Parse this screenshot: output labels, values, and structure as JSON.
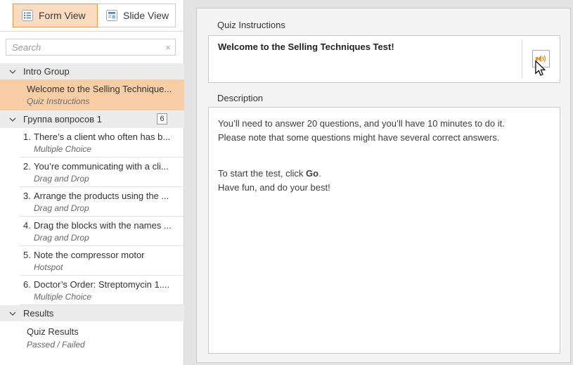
{
  "colors": {
    "window-bg": "#e3e3e3",
    "tab-selected-bg": "#fbdcc0",
    "tab-selected-border": "#e19a50",
    "group-header-bg": "#ececec",
    "selected-item-bg": "#f9cda5",
    "icon-blue": "#3c77b8",
    "speaker-orange": "#df9821"
  },
  "sidebar": {
    "tabs": [
      {
        "label": "Form View"
      },
      {
        "label": "Slide View"
      }
    ],
    "search": {
      "placeholder": "Search",
      "clear_glyph": "×"
    },
    "groups": [
      {
        "label": "Intro Group",
        "items": [
          {
            "title": "Welcome to the Selling Technique...",
            "type": "Quiz Instructions"
          }
        ]
      },
      {
        "label": "Группа вопросов 1",
        "badge": "6",
        "items": [
          {
            "num": "1.",
            "title": "There’s a client who often has b...",
            "type": "Multiple Choice"
          },
          {
            "num": "2.",
            "title": "You’re communicating with a cli...",
            "type": "Drag and Drop"
          },
          {
            "num": "3.",
            "title": "Arrange the products using the ...",
            "type": "Drag and Drop"
          },
          {
            "num": "4.",
            "title": "Drag the blocks with the names ...",
            "type": "Drag and Drop"
          },
          {
            "num": "5.",
            "title": "Note the compressor motor",
            "type": "Hotspot"
          },
          {
            "num": "6.",
            "title": "Doctor’s Order: Streptomycin 1....",
            "type": "Multiple Choice"
          }
        ]
      },
      {
        "label": "Results",
        "items": [
          {
            "title": "Quiz Results",
            "type": "Passed / Failed"
          }
        ]
      }
    ]
  },
  "main": {
    "quiz_instructions_label": "Quiz Instructions",
    "title": "Welcome to the Selling Techniques Test!",
    "description_label": "Description",
    "description": {
      "line1": "You’ll need to answer 20 questions, and you’ll have 10 minutes to do it.",
      "line2": "Please note that some questions might have several correct answers.",
      "line3_prefix": "To start the test, click ",
      "line3_bold": "Go",
      "line3_suffix": ".",
      "line4": "Have fun, and do your best!"
    }
  }
}
